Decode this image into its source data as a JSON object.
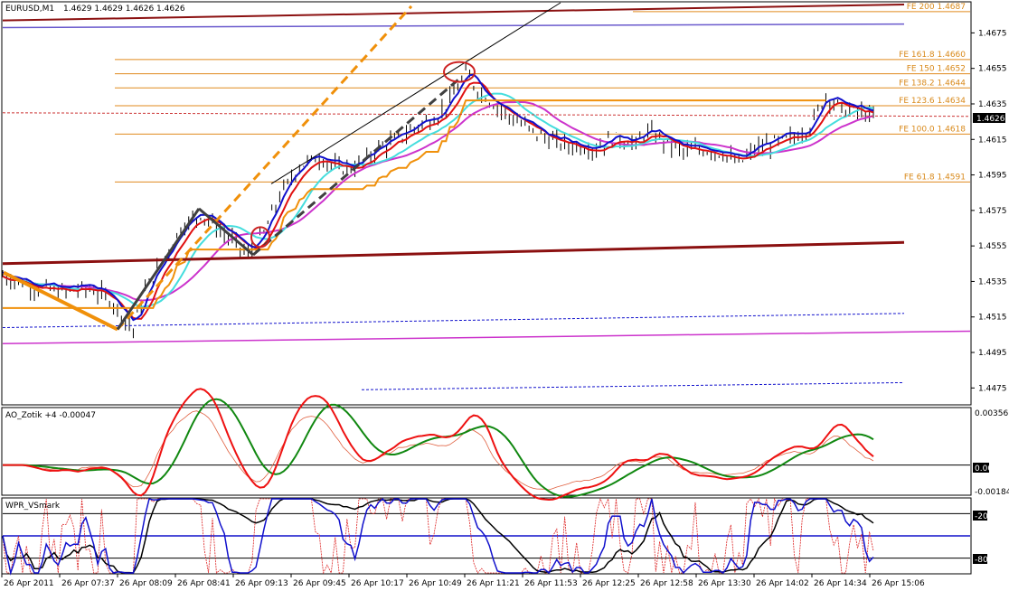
{
  "header": {
    "symbol": "EURUSD,M1",
    "ohlc": "1.4629 1.4629 1.4626 1.4626"
  },
  "chart_data": [
    {
      "type": "line",
      "title": "EURUSD,M1  1.4629 1.4629 1.4626 1.4626",
      "x_ticks": [
        "26 Apr 2011",
        "26 Apr 07:37",
        "26 Apr 08:09",
        "26 Apr 08:41",
        "26 Apr 09:13",
        "26 Apr 09:45",
        "26 Apr 10:17",
        "26 Apr 10:49",
        "26 Apr 11:21",
        "26 Apr 11:53",
        "26 Apr 12:25",
        "26 Apr 12:58",
        "26 Apr 13:30",
        "26 Apr 14:02",
        "26 Apr 14:34",
        "26 Apr 15:06"
      ],
      "y_ticks": [
        "1.4675",
        "1.4655",
        "1.4635",
        "1.4615",
        "1.4595",
        "1.4575",
        "1.4555",
        "1.4535",
        "1.4515",
        "1.4495",
        "1.4475"
      ],
      "ylim": [
        1.4466,
        1.4692
      ],
      "current_price": "1.4626",
      "fib_levels": [
        {
          "label": "FE 200  1.4687",
          "value": 1.4687
        },
        {
          "label": "FE 161.8  1.4660",
          "value": 1.466
        },
        {
          "label": "FE 150  1.4652",
          "value": 1.4652
        },
        {
          "label": "FE 138.2  1.4644",
          "value": 1.4644
        },
        {
          "label": "FE 123.6  1.4634",
          "value": 1.4634
        },
        {
          "label": "FE 100.0  1.4618",
          "value": 1.4618
        },
        {
          "label": "FE 61.8  1.4591",
          "value": 1.4591
        }
      ],
      "price_path": [
        [
          0,
          1.4538
        ],
        [
          8,
          1.4532
        ],
        [
          15,
          1.4529
        ],
        [
          22,
          1.4531
        ],
        [
          27,
          1.4525
        ],
        [
          33,
          1.4508
        ],
        [
          36,
          1.453
        ],
        [
          40,
          1.4545
        ],
        [
          45,
          1.4565
        ],
        [
          50,
          1.4573
        ],
        [
          54,
          1.4566
        ],
        [
          58,
          1.4558
        ],
        [
          62,
          1.455
        ],
        [
          66,
          1.4562
        ],
        [
          70,
          1.4583
        ],
        [
          75,
          1.46
        ],
        [
          80,
          1.4605
        ],
        [
          85,
          1.4598
        ],
        [
          90,
          1.46
        ],
        [
          95,
          1.461
        ],
        [
          100,
          1.4615
        ],
        [
          105,
          1.4623
        ],
        [
          110,
          1.4628
        ],
        [
          114,
          1.464
        ],
        [
          117,
          1.4652
        ],
        [
          120,
          1.4643
        ],
        [
          125,
          1.4633
        ],
        [
          130,
          1.4625
        ],
        [
          135,
          1.4618
        ],
        [
          140,
          1.4613
        ],
        [
          145,
          1.4611
        ],
        [
          150,
          1.461
        ],
        [
          155,
          1.4616
        ],
        [
          160,
          1.4612
        ],
        [
          163,
          1.4619
        ],
        [
          167,
          1.4614
        ],
        [
          172,
          1.4608
        ],
        [
          177,
          1.4609
        ],
        [
          182,
          1.4607
        ],
        [
          186,
          1.4601
        ],
        [
          190,
          1.4609
        ],
        [
          195,
          1.4613
        ],
        [
          200,
          1.4616
        ],
        [
          204,
          1.4622
        ],
        [
          208,
          1.464
        ],
        [
          212,
          1.4632
        ],
        [
          216,
          1.4631
        ],
        [
          220,
          1.4627
        ]
      ]
    },
    {
      "type": "line",
      "title": "AO_Zotik +4 -0.00047",
      "y_ticks": [
        "0.00356",
        "0.00",
        "-0.00184"
      ],
      "ylim": [
        -0.00184,
        0.00356
      ]
    },
    {
      "type": "line",
      "title": "WPR_VSmark",
      "y_ticks": [
        "-20",
        "-80"
      ],
      "ylim": [
        -100,
        0
      ]
    }
  ]
}
